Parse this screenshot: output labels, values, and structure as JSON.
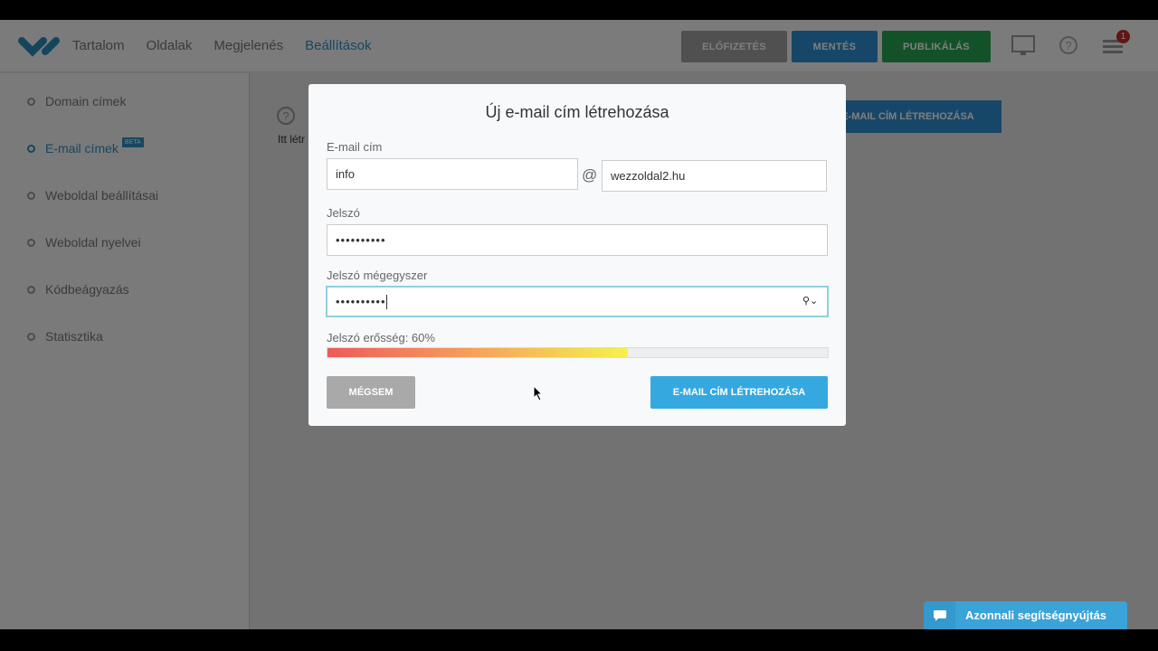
{
  "header": {
    "nav": [
      "Tartalom",
      "Oldalak",
      "Megjelenés",
      "Beállítások"
    ],
    "active_nav": "Beállítások",
    "buttons": {
      "subscribe": "ELŐFIZETÉS",
      "save": "MENTÉS",
      "publish": "PUBLIKÁLÁS"
    },
    "notification_count": "1"
  },
  "sidebar": {
    "items": [
      {
        "label": "Domain címek"
      },
      {
        "label": "E-mail címek",
        "badge": "BETA"
      },
      {
        "label": "Weboldal beállításai"
      },
      {
        "label": "Weboldal nyelvei"
      },
      {
        "label": "Kódbeágyazás"
      },
      {
        "label": "Statisztika"
      }
    ],
    "active": "E-mail címek"
  },
  "main": {
    "intro_text": "Itt létr",
    "create_button": "E-MAIL CÍM LÉTREHOZÁSA"
  },
  "modal": {
    "title": "Új e-mail cím létrehozása",
    "email_label": "E-mail cím",
    "email_local": "info",
    "at": "@",
    "email_domain": "wezzoldal2.hu",
    "password_label": "Jelszó",
    "password_value": "••••••••••",
    "password_repeat_label": "Jelszó mégegyszer",
    "password_repeat_value": "••••••••••",
    "strength_label": "Jelszó erősség: 60%",
    "strength_percent": 60,
    "cancel": "MÉGSEM",
    "submit": "E-MAIL CÍM LÉTREHOZÁSA"
  },
  "chat": {
    "label": "Azonnali segítségnyújtás"
  },
  "colors": {
    "accent": "#2c8fc2",
    "save": "#2e8ed0",
    "publish": "#27a451",
    "submit": "#35a8e0"
  }
}
